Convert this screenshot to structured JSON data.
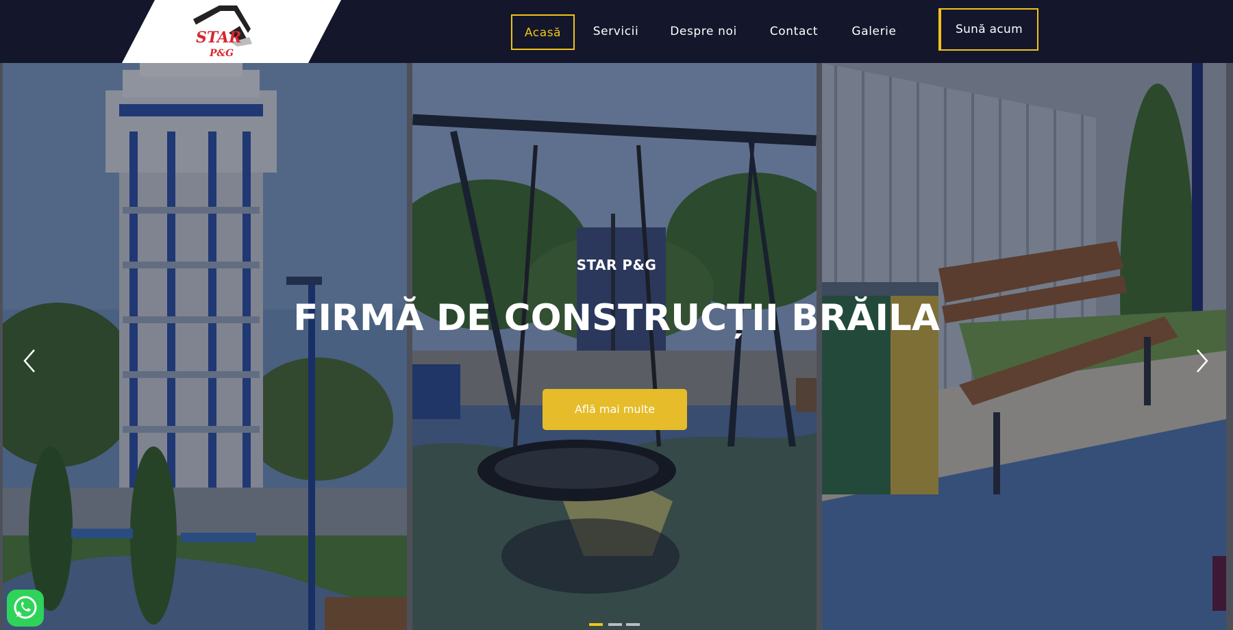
{
  "brand": {
    "logo_top_text": "STAR",
    "logo_bottom_text": "P&G",
    "logo_red": "#d7262e",
    "logo_dark": "#222222"
  },
  "nav": {
    "items": [
      {
        "label": "Acasă",
        "active": true
      },
      {
        "label": "Servicii",
        "active": false
      },
      {
        "label": "Despre noi",
        "active": false
      },
      {
        "label": "Contact",
        "active": false
      },
      {
        "label": "Galerie",
        "active": false
      }
    ],
    "cta_label": "Sună acum"
  },
  "hero": {
    "eyebrow": "STAR P&G",
    "headline": "FIRMĂ DE CONSTRUCȚII BRĂILA",
    "button_label": "Află mai multe",
    "prev_icon": "chevron-left-icon",
    "next_icon": "chevron-right-icon",
    "slides_total": 3,
    "slide_active": 1
  },
  "floating": {
    "whatsapp_icon": "whatsapp-icon"
  },
  "colors": {
    "header_bg": "#14172b",
    "accent": "#f2c318",
    "hero_button": "#e6bc2a",
    "whatsapp": "#2fd35a"
  }
}
